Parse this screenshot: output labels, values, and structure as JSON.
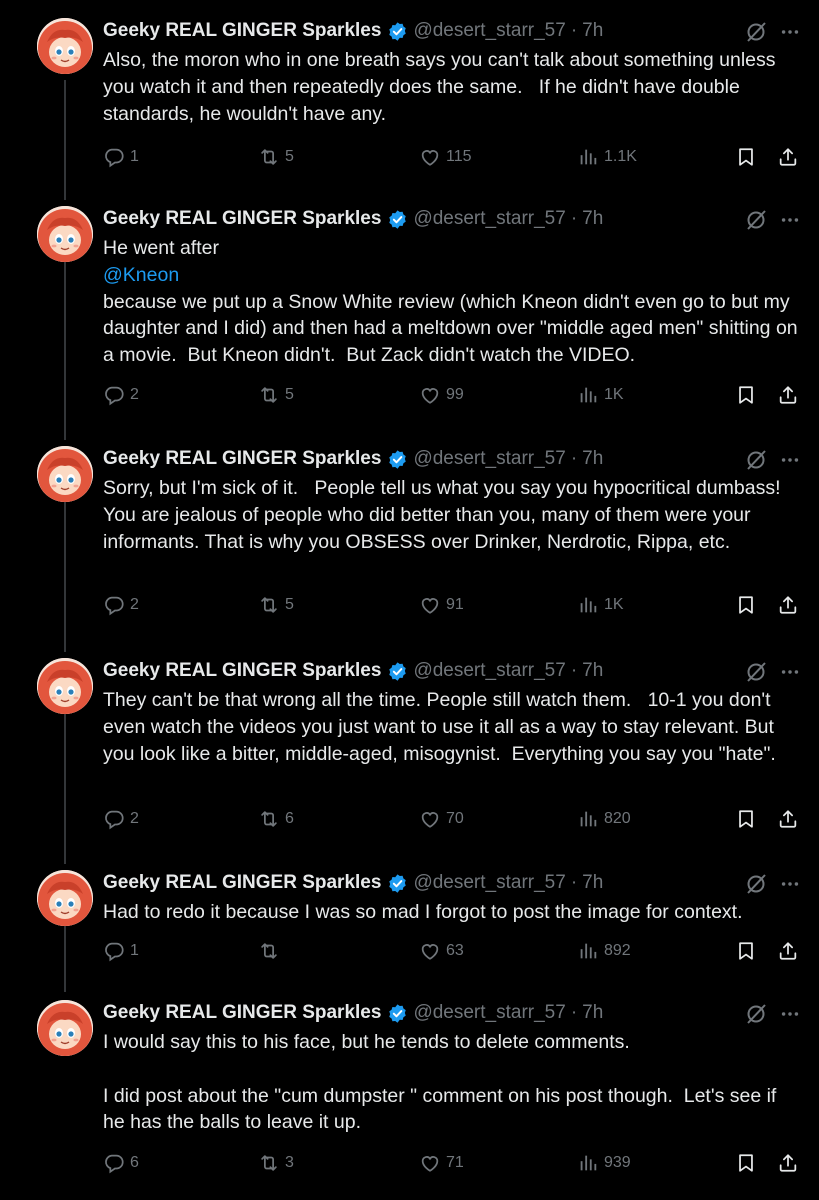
{
  "author": {
    "name": "Geeky REAL GINGER Sparkles",
    "handle": "@desert_starr_57",
    "time": "7h"
  },
  "icons": [
    "reply-icon",
    "retweet-icon",
    "like-icon",
    "views-icon",
    "bookmark-icon",
    "share-icon",
    "grok-icon",
    "more-icon",
    "verified-icon"
  ],
  "colors": {
    "background": "#000000",
    "text": "#e7e9ea",
    "muted": "#71767b",
    "accent": "#1d9bf0"
  },
  "tweets": [
    {
      "text": "Also, the moron who in one breath says you can't talk about something unless you watch it and then repeatedly does the same.   If he didn't have double standards, he wouldn't have any.",
      "replies": "1",
      "retweets": "5",
      "likes": "115",
      "views": "1.1K"
    },
    {
      "text_before": "He went after",
      "mention": "@Kneon",
      "text_after": "because we put up a Snow White review (which Kneon didn't even go to but my daughter and I did) and then had a meltdown over \"middle aged men\" shitting on a movie.  But Kneon didn't.  But Zack didn't watch the VIDEO.",
      "replies": "2",
      "retweets": "5",
      "likes": "99",
      "views": "1K"
    },
    {
      "text": "Sorry, but I'm sick of it.   People tell us what you say you hypocritical dumbass!  You are jealous of people who did better than you, many of them were your informants. That is why you OBSESS over Drinker, Nerdrotic, Rippa, etc.",
      "replies": "2",
      "retweets": "5",
      "likes": "91",
      "views": "1K"
    },
    {
      "text": "They can't be that wrong all the time. People still watch them.   10-1 you don't even watch the videos you just want to use it all as a way to stay relevant. But you look like a bitter, middle-aged, misogynist.  Everything you say you \"hate\".",
      "replies": "2",
      "retweets": "6",
      "likes": "70",
      "views": "820"
    },
    {
      "text": "Had to redo it because I was so mad I forgot to post the image for context.",
      "replies": "1",
      "retweets": "",
      "likes": "63",
      "views": "892"
    },
    {
      "text": "I would say this to his face, but he tends to delete comments.\n\nI did post about the \"cum dumpster \" comment on his post though.  Let's see if he has the balls to leave it up.",
      "replies": "6",
      "retweets": "3",
      "likes": "71",
      "views": "939"
    }
  ]
}
